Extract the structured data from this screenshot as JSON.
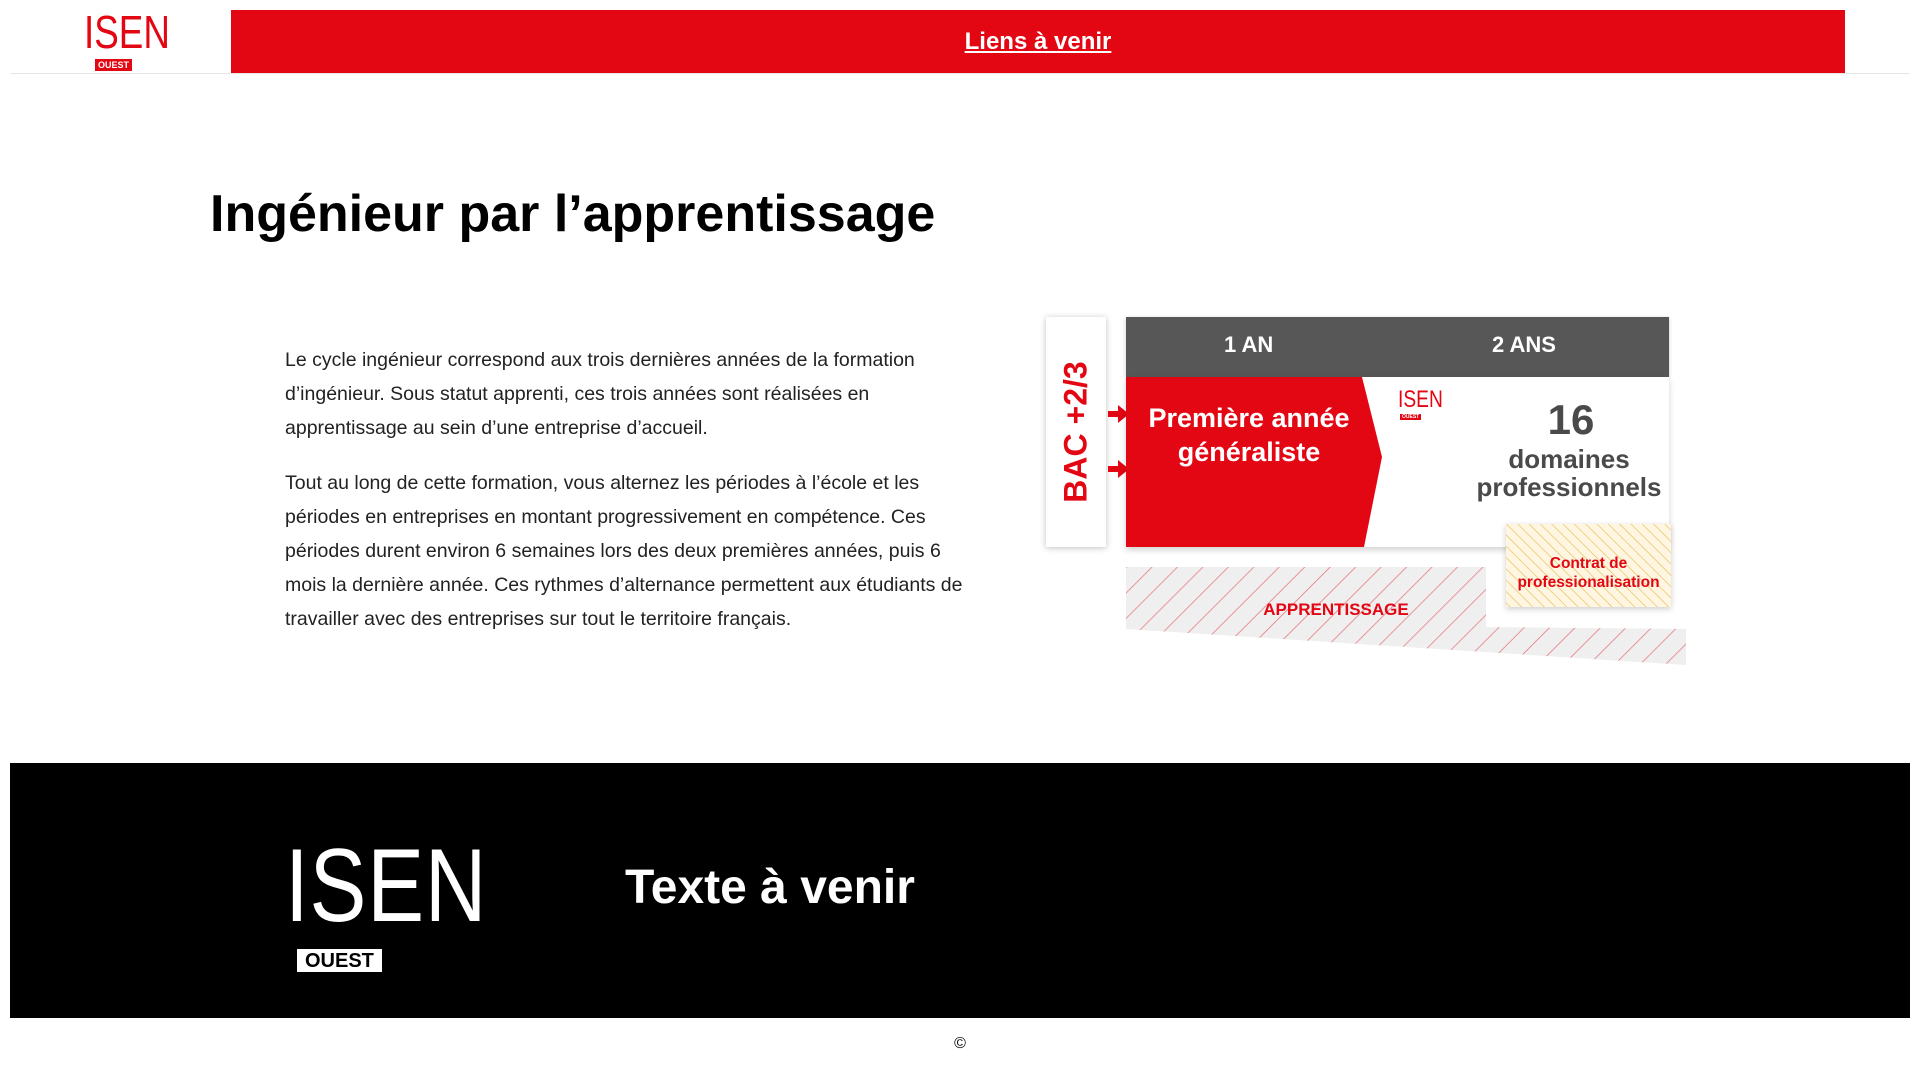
{
  "header": {
    "logo_text": "ISEN",
    "logo_subtext": "OUEST",
    "link_label": "Liens à venir"
  },
  "main": {
    "title": "Ingénieur par l’apprentissage",
    "paragraphs": [
      "Le cycle ingénieur correspond aux trois dernières années de la formation d’ingénieur. Sous statut apprenti, ces trois années sont réalisées en apprentissage au sein d’une entreprise d’accueil.",
      "Tout au long de cette formation, vous alternez les périodes à l’école et les périodes en entreprises en montant progressivement en compétence. Ces périodes durent environ 6 semaines lors des deux premières années, puis 6 mois la dernière année. Ces rythmes d’alternance permettent aux étudiants de travailler avec des entreprises sur tout le territoire français."
    ]
  },
  "diagram": {
    "bac_label": "BAC +2/3",
    "year1_label": "1 AN",
    "year2_label": "2 ANS",
    "first_year_text": "Première année généraliste",
    "mini_logo_text": "ISEN",
    "mini_logo_subtext": "OUEST",
    "domains_count": "16",
    "domains_text": "domaines professionnels",
    "apprentissage_label": "APPRENTISSAGE",
    "contrat_text": "Contrat de professionalisation"
  },
  "footer": {
    "logo_text": "ISEN",
    "logo_subtext": "OUEST",
    "text": "Texte à venir",
    "copyright": "©"
  },
  "colors": {
    "brand_red": "#e30613",
    "dark_gray": "#575757",
    "footer_bg": "#000000"
  }
}
